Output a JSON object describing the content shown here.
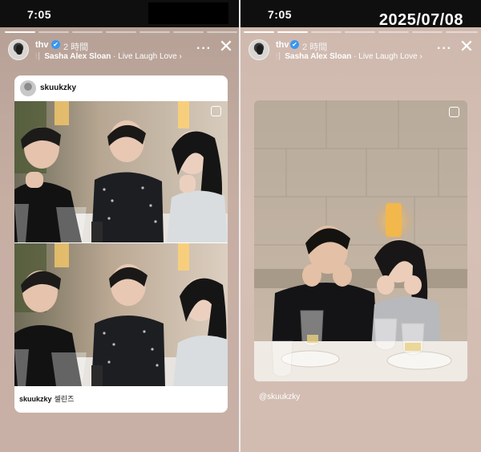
{
  "left_story": {
    "status_time": "7:05",
    "progress": {
      "segments": 7,
      "completed": 1
    },
    "header": {
      "username": "thv",
      "verified_mark": "✔",
      "time_ago": "2 時間",
      "song": "Sasha Alex Sloan",
      "song_separator": "·",
      "song_title": "Live Laugh Love",
      "song_chevron": "›"
    },
    "post": {
      "author": "skuukzky",
      "caption_user": "skuukzky",
      "caption_text": "셀린즈"
    },
    "icons": [
      "music-icon",
      "more-icon",
      "close-icon",
      "carousel-icon"
    ]
  },
  "right_story": {
    "status_time": "7:05",
    "date_stamp": "2025/07/08",
    "progress": {
      "segments": 7,
      "completed": 2
    },
    "header": {
      "username": "thv",
      "verified_mark": "✔",
      "time_ago": "2 時間",
      "song": "Sasha Alex Sloan",
      "song_separator": "·",
      "song_title": "Live Laugh Love",
      "song_chevron": "›"
    },
    "mention": "@skuukzky",
    "icons": [
      "music-icon",
      "more-icon",
      "close-icon",
      "carousel-icon"
    ]
  },
  "symbols": {
    "more": "···",
    "close": "✕",
    "music": "⫶⏐"
  },
  "colors": {
    "verified": "#3897f0",
    "status_bar": "#0f0f0f",
    "left_bg": "#c7aea3",
    "right_bg": "#d6c0b6"
  }
}
